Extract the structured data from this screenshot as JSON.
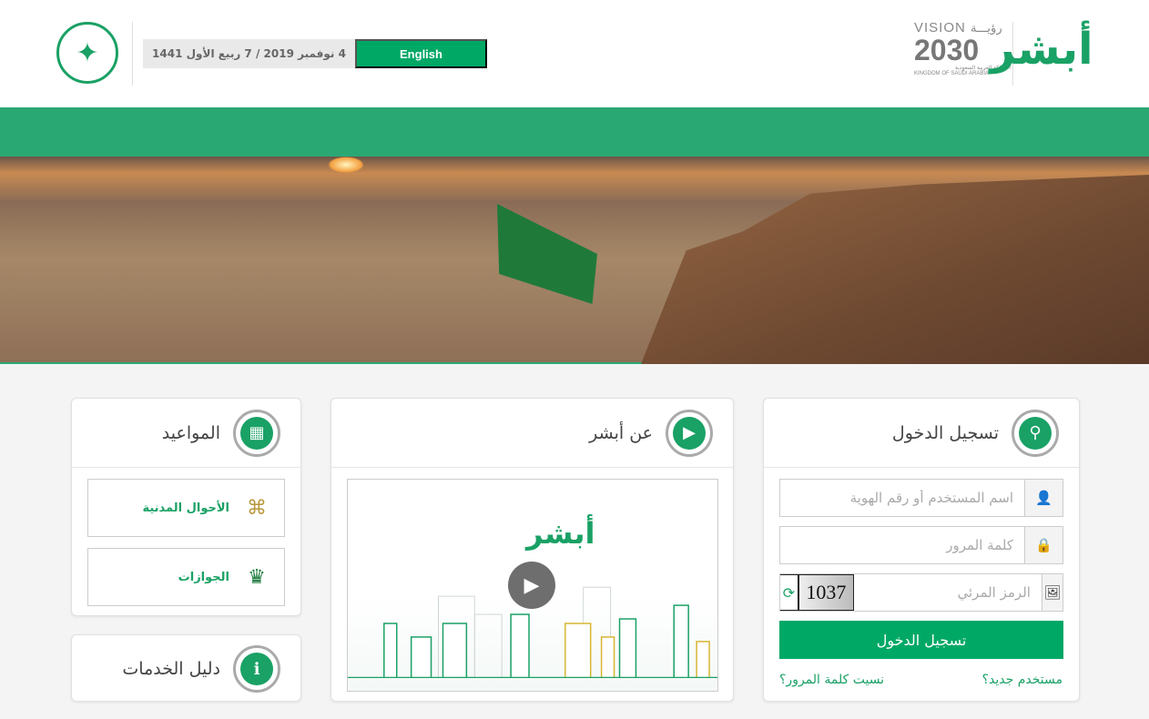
{
  "header": {
    "date": "4 نوفمبر 2019 / 7 ربيع الأول 1441",
    "language_button": "English",
    "vision_logo": {
      "word": "VISION",
      "arabic": "رؤيـــة",
      "year": "2030",
      "sub_ar": "المملكة العربية السعودية",
      "sub_en": "KINGDOM OF SAUDI ARABIA"
    },
    "absher_logo": "أبشر"
  },
  "login": {
    "title": "تسجيل الدخول",
    "username_placeholder": "اسم المستخدم أو رقم الهوية",
    "password_placeholder": "كلمة المرور",
    "captcha_placeholder": "الرمز المرئي",
    "captcha_value": "1037",
    "submit": "تسجيل الدخول",
    "new_user": "مستخدم جديد؟",
    "forgot_password": "نسيت كلمة المرور؟"
  },
  "about": {
    "title": "عن أبشر",
    "video_logo": "أبشر"
  },
  "appointments": {
    "title": "المواعيد",
    "items": [
      {
        "label": "الأحوال المدنية",
        "logo_text": "الأحوال المدنية"
      },
      {
        "label": "الجوازات"
      }
    ]
  },
  "services_guide": {
    "title": "دليل الخدمات"
  },
  "colors": {
    "brand_green": "#00a866",
    "strip_green": "#2aa874"
  }
}
